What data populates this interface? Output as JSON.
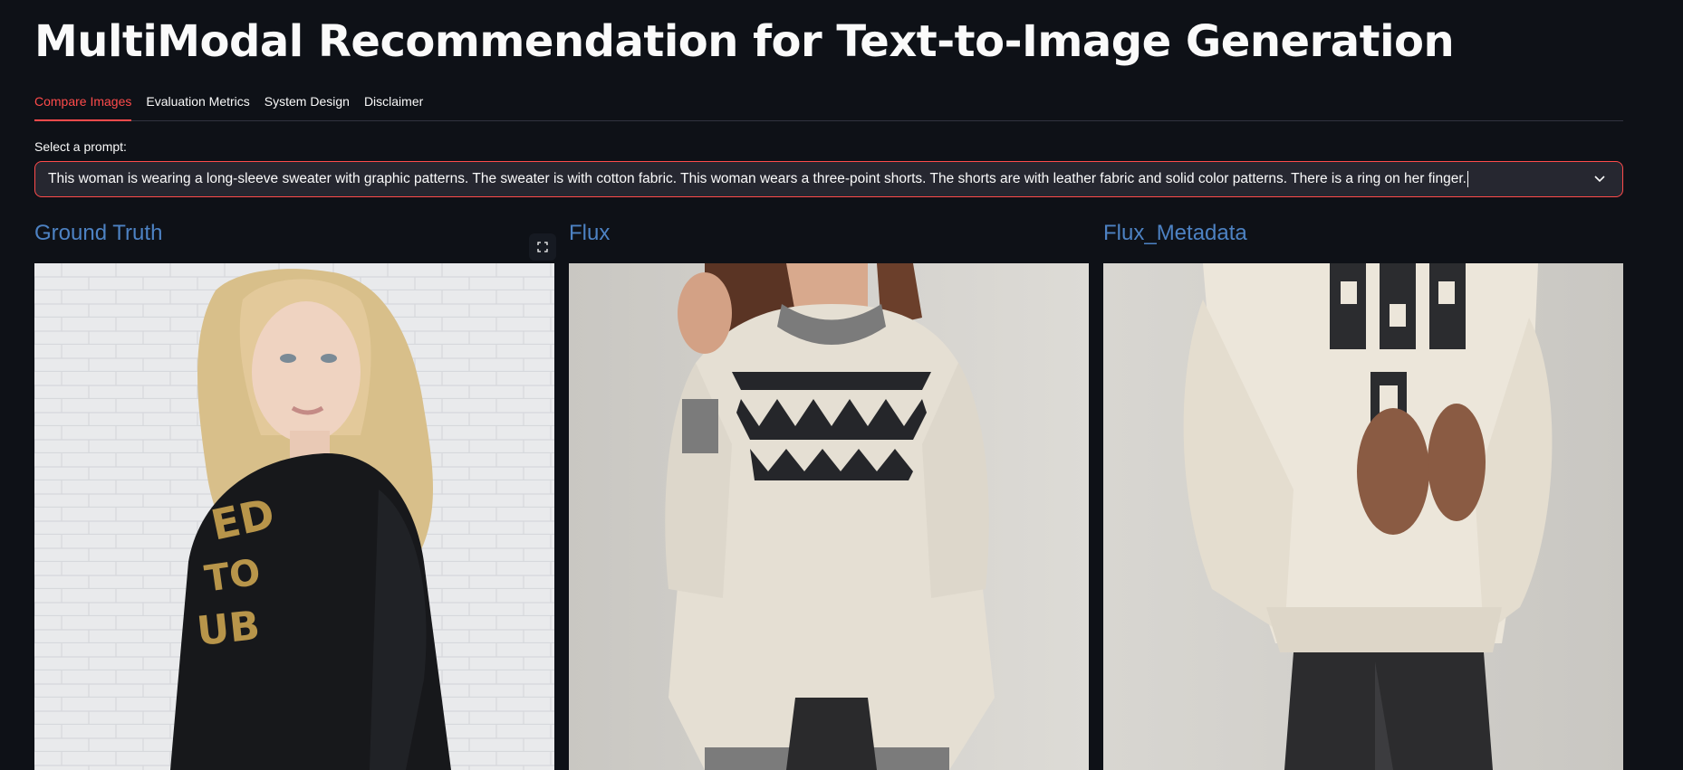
{
  "app": {
    "title": "MultiModal Recommendation for Text-to-Image Generation"
  },
  "tabs": [
    {
      "label": "Compare Images",
      "active": true
    },
    {
      "label": "Evaluation Metrics",
      "active": false
    },
    {
      "label": "System Design",
      "active": false
    },
    {
      "label": "Disclaimer",
      "active": false
    }
  ],
  "prompt_select": {
    "label": "Select a prompt:",
    "value": "This woman is wearing a long-sleeve sweater with graphic patterns. The sweater is with cotton fabric. This woman wears a three-point shorts. The shorts are with leather fabric and solid color patterns. There is a ring on her finger."
  },
  "columns": [
    {
      "title": "Ground Truth"
    },
    {
      "title": "Flux"
    },
    {
      "title": "Flux_Metadata"
    }
  ],
  "icons": {
    "expand": "fullscreen-icon",
    "dropdown": "chevron-down-icon"
  },
  "colors": {
    "background": "#0e1117",
    "accent": "#ff4b4b",
    "heading_link": "#4d82c3",
    "input_bg": "#262730"
  }
}
